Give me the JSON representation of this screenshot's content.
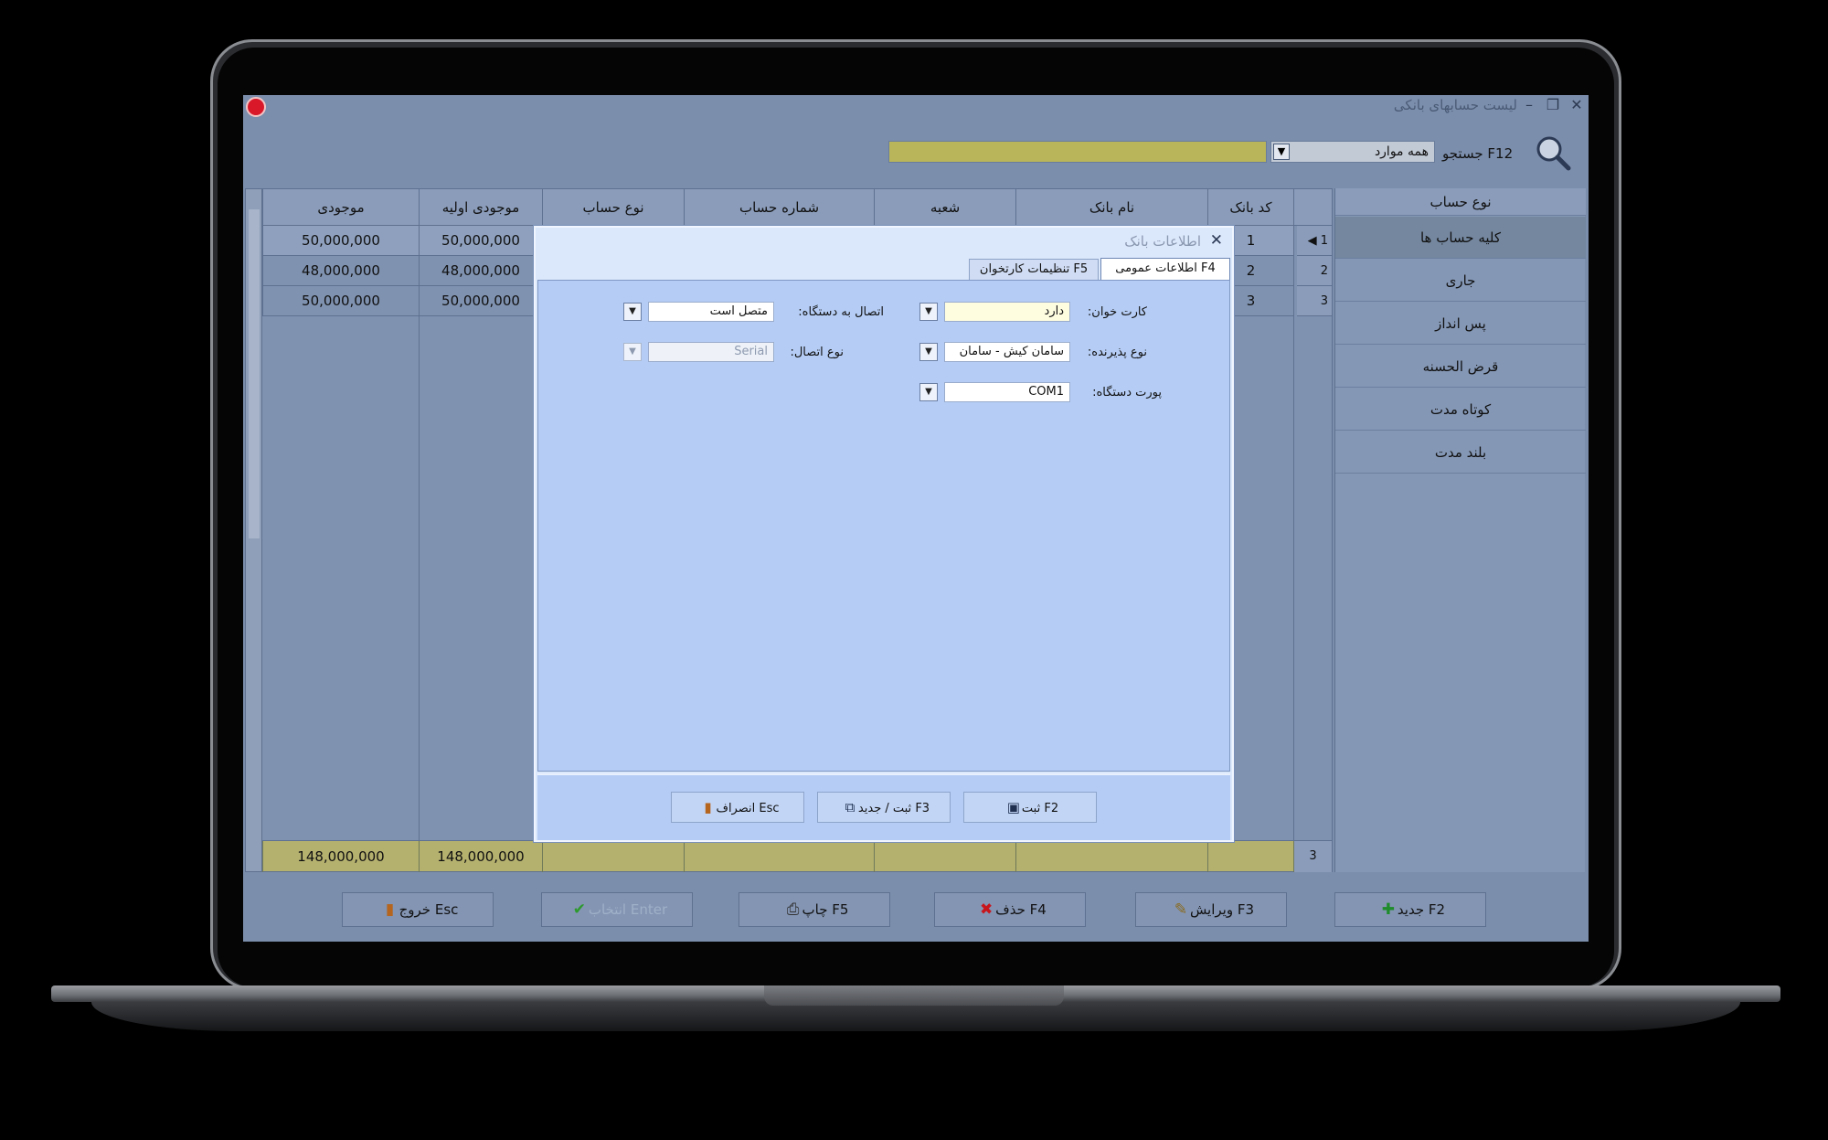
{
  "app": {
    "title": "لیست حسابهای بانکی",
    "window_controls": {
      "minimize": "–",
      "restore": "❐",
      "close": "✕"
    }
  },
  "search": {
    "label": "جستجو F12",
    "scope_value": "همه موارد",
    "query_value": ""
  },
  "filter_panel": {
    "header": "نوع حساب",
    "items": [
      "کلیه حساب ها",
      "جاری",
      "پس انداز",
      "قرض الحسنه",
      "کوتاه مدت",
      "بلند مدت"
    ],
    "selected_index": 0
  },
  "grid": {
    "columns": [
      "کد بانک",
      "نام بانک",
      "شعبه",
      "شماره حساب",
      "نوع حساب",
      "موجودی اولیه",
      "موجودی"
    ],
    "rows": [
      {
        "row_no": "1",
        "code": "1",
        "initial": "50,000,000",
        "balance": "50,000,000"
      },
      {
        "row_no": "2",
        "code": "2",
        "initial": "48,000,000",
        "balance": "48,000,000"
      },
      {
        "row_no": "3",
        "code": "3",
        "initial": "50,000,000",
        "balance": "50,000,000"
      }
    ],
    "footer": {
      "count": "3",
      "initial_total": "148,000,000",
      "balance_total": "148,000,000"
    }
  },
  "toolbar": {
    "new": "جدید F2",
    "edit": "ویرایش F3",
    "delete": "حذف F4",
    "print": "چاپ F5",
    "select": "انتخاب Enter",
    "exit": "خروج Esc"
  },
  "modal": {
    "title": "اطلاعات بانک",
    "tabs": {
      "general": "اطلاعات عمومی F4",
      "card_reader": "تنظیمات کارتخوان F5"
    },
    "fields": {
      "card_reader": {
        "label": "کارت خوان:",
        "value": "دارد"
      },
      "acceptor_type": {
        "label": "نوع پذیرنده:",
        "value": "سامان کیش - سامان"
      },
      "device_port": {
        "label": "پورت دستگاه:",
        "value": "COM1"
      },
      "device_connection": {
        "label": "اتصال به دستگاه:",
        "value": "متصل است"
      },
      "connection_type": {
        "label": "نوع اتصال:",
        "value": "Serial"
      }
    },
    "buttons": {
      "save": "ثبت F2",
      "save_new": "ثبت / جدید F3",
      "cancel": "انصراف Esc"
    }
  },
  "colors": {
    "app_bg": "#7b8eac",
    "modal_body": "#b5cdf5",
    "search_highlight": "#b9b55a",
    "footer_row": "#b4b06e",
    "logo_red": "#d9182a"
  }
}
